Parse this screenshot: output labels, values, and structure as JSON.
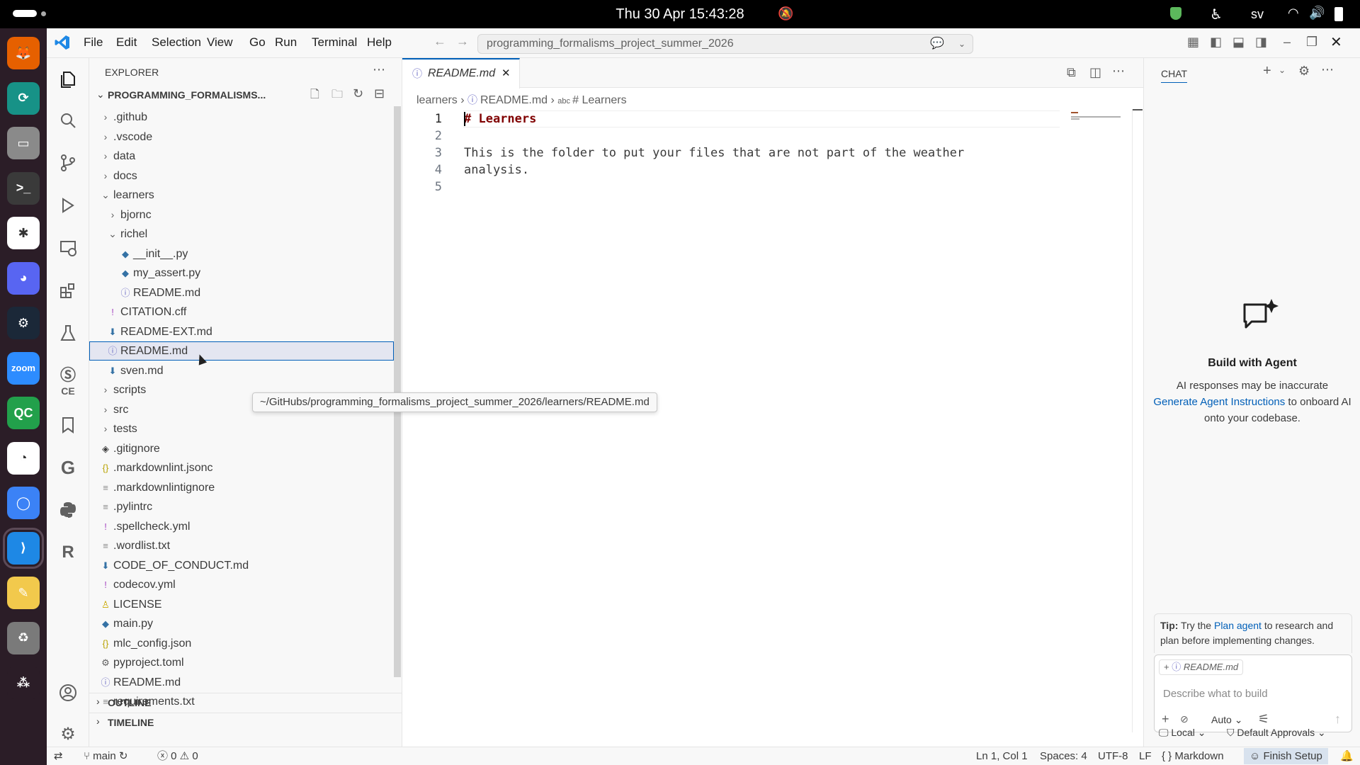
{
  "system": {
    "clock": "Thu 30 Apr  15:43:28",
    "lang": "sv"
  },
  "dock": [
    {
      "name": "firefox-icon",
      "color": "#e66000",
      "glyph": "🦊"
    },
    {
      "name": "gitkraken-icon",
      "color": "#179287",
      "glyph": "⟳"
    },
    {
      "name": "files-icon",
      "color": "#8a8a8a",
      "glyph": "▭"
    },
    {
      "name": "terminal-icon",
      "color": "#3a3a3a",
      "glyph": ">_"
    },
    {
      "name": "slack-icon",
      "color": "#ffffff",
      "glyph": "✱"
    },
    {
      "name": "discord-icon",
      "color": "#5865f2",
      "glyph": "◕"
    },
    {
      "name": "steam-icon",
      "color": "#1b2838",
      "glyph": "⚙"
    },
    {
      "name": "zoom-icon",
      "color": "#2d8cff",
      "glyph": "zoom"
    },
    {
      "name": "qc-icon",
      "color": "#22a04b",
      "glyph": "QC"
    },
    {
      "name": "app-icon",
      "color": "#ffffff",
      "glyph": "◔"
    },
    {
      "name": "chromium-icon",
      "color": "#3b82f6",
      "glyph": "◯"
    },
    {
      "name": "vscode-icon",
      "color": "#1e88e5",
      "glyph": "⟩"
    },
    {
      "name": "text-editor-icon",
      "color": "#f2c94c",
      "glyph": "✎"
    },
    {
      "name": "trash-icon",
      "color": "#7a7a7a",
      "glyph": "♻"
    },
    {
      "name": "ubuntu-icon",
      "color": "#2b1d27",
      "glyph": "⁂"
    }
  ],
  "menu": [
    "File",
    "Edit",
    "Selection",
    "View",
    "Go",
    "Run",
    "Terminal",
    "Help"
  ],
  "search": {
    "text": "programming_formalisms_project_summer_2026"
  },
  "explorer": {
    "title": "EXPLORER",
    "root": "PROGRAMMING_FORMALISMS...",
    "items": [
      {
        "label": ".github",
        "depth": 0,
        "type": "folder",
        "open": false
      },
      {
        "label": ".vscode",
        "depth": 0,
        "type": "folder",
        "open": false
      },
      {
        "label": "data",
        "depth": 0,
        "type": "folder",
        "open": false
      },
      {
        "label": "docs",
        "depth": 0,
        "type": "folder",
        "open": false
      },
      {
        "label": "learners",
        "depth": 0,
        "type": "folder",
        "open": true
      },
      {
        "label": "bjornc",
        "depth": 1,
        "type": "folder",
        "open": false
      },
      {
        "label": "richel",
        "depth": 1,
        "type": "folder",
        "open": true
      },
      {
        "label": "__init__.py",
        "depth": 2,
        "type": "py"
      },
      {
        "label": "my_assert.py",
        "depth": 2,
        "type": "py"
      },
      {
        "label": "README.md",
        "depth": 2,
        "type": "info"
      },
      {
        "label": "CITATION.cff",
        "depth": 1,
        "type": "excl"
      },
      {
        "label": "README-EXT.md",
        "depth": 1,
        "type": "md"
      },
      {
        "label": "README.md",
        "depth": 1,
        "type": "info",
        "selected": true
      },
      {
        "label": "sven.md",
        "depth": 1,
        "type": "md"
      },
      {
        "label": "scripts",
        "depth": 0,
        "type": "folder",
        "open": false
      },
      {
        "label": "src",
        "depth": 0,
        "type": "folder",
        "open": false
      },
      {
        "label": "tests",
        "depth": 0,
        "type": "folder",
        "open": false
      },
      {
        "label": ".gitignore",
        "depth": 0,
        "type": "git"
      },
      {
        "label": ".markdownlint.jsonc",
        "depth": 0,
        "type": "json"
      },
      {
        "label": ".markdownlintignore",
        "depth": 0,
        "type": "txt"
      },
      {
        "label": ".pylintrc",
        "depth": 0,
        "type": "txt"
      },
      {
        "label": ".spellcheck.yml",
        "depth": 0,
        "type": "excl"
      },
      {
        "label": ".wordlist.txt",
        "depth": 0,
        "type": "txt"
      },
      {
        "label": "CODE_OF_CONDUCT.md",
        "depth": 0,
        "type": "md"
      },
      {
        "label": "codecov.yml",
        "depth": 0,
        "type": "excl"
      },
      {
        "label": "LICENSE",
        "depth": 0,
        "type": "license"
      },
      {
        "label": "main.py",
        "depth": 0,
        "type": "py"
      },
      {
        "label": "mlc_config.json",
        "depth": 0,
        "type": "json"
      },
      {
        "label": "pyproject.toml",
        "depth": 0,
        "type": "gear"
      },
      {
        "label": "README.md",
        "depth": 0,
        "type": "info"
      },
      {
        "label": "requirements.txt",
        "depth": 0,
        "type": "txt"
      }
    ],
    "outline": "OUTLINE",
    "timeline": "TIMELINE",
    "tooltip": "~/GitHubs/programming_formalisms_project_summer_2026/learners/README.md"
  },
  "editor": {
    "tab": "README.md",
    "breadcrumbs": [
      "learners",
      "README.md",
      "# Learners"
    ],
    "lines": [
      {
        "n": "1",
        "text": "# Learners",
        "heading": true
      },
      {
        "n": "2",
        "text": ""
      },
      {
        "n": "3",
        "text": "This is the folder to put your files that are not part of the weather"
      },
      {
        "n": "4",
        "text": "analysis."
      },
      {
        "n": "5",
        "text": ""
      }
    ]
  },
  "chat": {
    "title": "CHAT",
    "heading": "Build with Agent",
    "line1": "AI responses may be inaccurate",
    "link": "Generate Agent Instructions",
    "line2": " to onboard AI",
    "line3": "onto your codebase.",
    "tip_label": "Tip:",
    "tip_pre": " Try the ",
    "tip_link": "Plan agent",
    "tip_post": " to research and plan before implementing changes.",
    "context_file": "README.md",
    "input_placeholder": "Describe what to build",
    "mode": "Auto",
    "local": "Local",
    "approvals": "Default Approvals"
  },
  "status": {
    "branch": "main",
    "errors": "0",
    "warnings": "0",
    "position": "Ln 1, Col 1",
    "spaces": "Spaces: 4",
    "encoding": "UTF-8",
    "eol": "LF",
    "language": "Markdown",
    "finish": "Finish Setup"
  }
}
